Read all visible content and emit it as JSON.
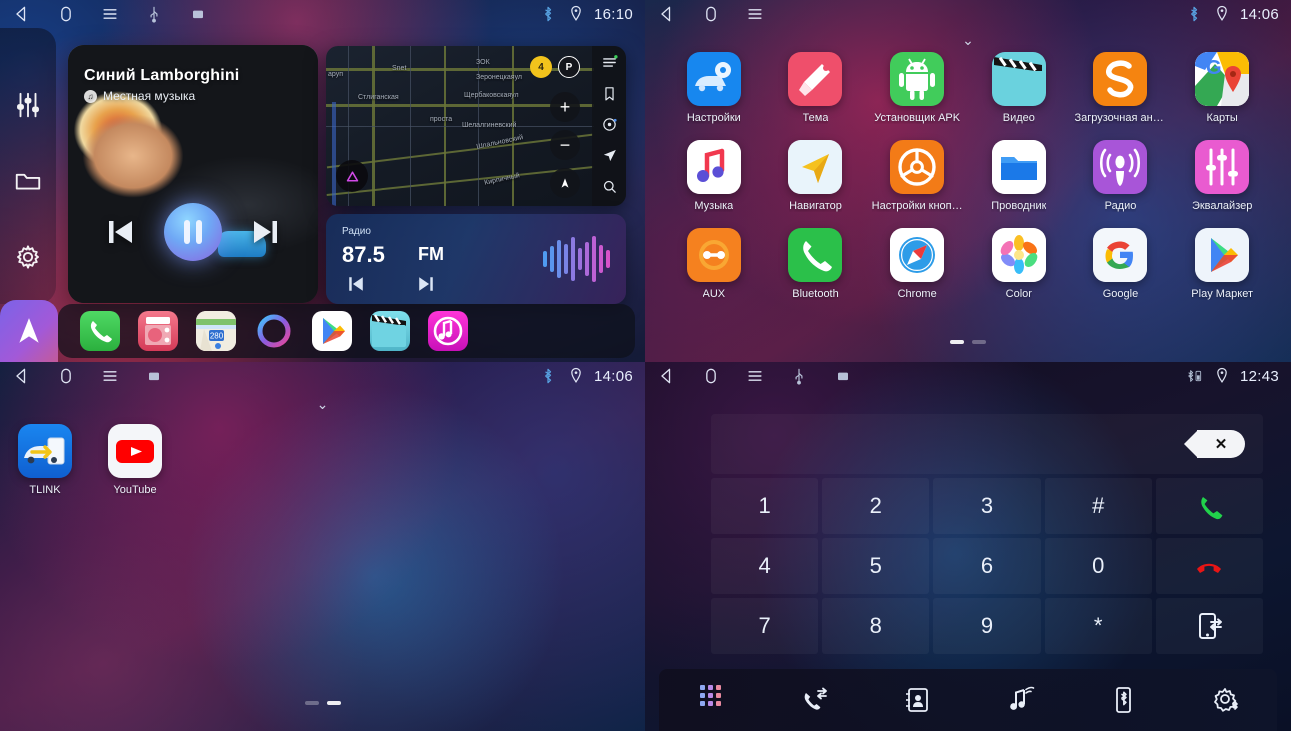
{
  "panels": {
    "media_home": {
      "name": "Media Home Screen",
      "statusbar": {
        "time": "16:10",
        "icons": [
          "back-icon",
          "home-icon",
          "menu-icon",
          "usb-icon",
          "screenshot-icon",
          "bluetooth-icon",
          "location-icon"
        ]
      },
      "sidebar": [
        {
          "name": "equalizer",
          "icon": "sliders-icon"
        },
        {
          "name": "files",
          "icon": "folder-icon"
        },
        {
          "name": "settings",
          "icon": "gear-icon"
        }
      ],
      "nav_tile": {
        "icon": "navigation-arrow-icon"
      },
      "media": {
        "title": "Синий Lamborghini",
        "subtitle": "Местная музыка",
        "source_badge": "♫",
        "prev_label": "prev",
        "play_state": "pause",
        "next_label": "next"
      },
      "map": {
        "labels": [
          "аруп",
          "ЗОК",
          "Зеронецкаяул",
          "Щербаковскаяул",
          "Стлиганская",
          "Шелалгиневский",
          "Шпальновский",
          "Кирпичный",
          "проста",
          "Snet"
        ],
        "badge_count": "4",
        "parking": "P",
        "zoom_in": "+",
        "zoom_out": "−",
        "rail_icons": [
          "menu-icon",
          "bookmark-icon",
          "music-disc-icon",
          "locate-icon",
          "search-icon"
        ]
      },
      "radio": {
        "label": "Радио",
        "frequency": "87.5",
        "band": "FM",
        "prev": "prev-station",
        "next": "next-station"
      },
      "dock": [
        {
          "name": "phone",
          "color": "#3ec152"
        },
        {
          "name": "radio",
          "color": "#e8566e"
        },
        {
          "name": "maps",
          "color": "#f2efe6"
        },
        {
          "name": "siri",
          "color": "#8a5ce0"
        },
        {
          "name": "play-store",
          "color": "#ffffff"
        },
        {
          "name": "video",
          "color": "#6fd0e0"
        },
        {
          "name": "music",
          "color": "#e418c8"
        }
      ]
    },
    "app_grid": {
      "name": "All Apps Screen",
      "statusbar": {
        "time": "14:06",
        "icons": [
          "back-icon",
          "home-icon",
          "menu-icon",
          "bluetooth-icon",
          "location-icon"
        ]
      },
      "pull_chevron": "⌄",
      "apps": [
        {
          "label": "Настройки",
          "icon": "car-settings-icon",
          "bg": "#1787ef"
        },
        {
          "label": "Тема",
          "icon": "brush-icon",
          "bg": "#ef4f6b"
        },
        {
          "label": "Установщик APK",
          "icon": "android-icon",
          "bg": "#41cc5b"
        },
        {
          "label": "Видео",
          "icon": "clapper-icon",
          "bg": "#6ad2de"
        },
        {
          "label": "Загрузочная ани…",
          "icon": "boot-anim-icon",
          "bg": "#f58410"
        },
        {
          "label": "Карты",
          "icon": "google-maps-icon",
          "bg": "#ffffff"
        },
        {
          "label": "Музыка",
          "icon": "music-note-icon",
          "bg": "#ffffff"
        },
        {
          "label": "Навигатор",
          "icon": "navigator-icon",
          "bg": "#e9f4fb"
        },
        {
          "label": "Настройки кноп…",
          "icon": "steering-wheel-icon",
          "bg": "#f37b17"
        },
        {
          "label": "Проводник",
          "icon": "file-manager-icon",
          "bg": "#ffffff"
        },
        {
          "label": "Радио",
          "icon": "podcast-icon",
          "bg": "#a855d8"
        },
        {
          "label": "Эквалайзер",
          "icon": "equalizer-icon",
          "bg": "#e95bd0"
        },
        {
          "label": "AUX",
          "icon": "aux-icon",
          "bg": "#f5811f"
        },
        {
          "label": "Bluetooth",
          "icon": "phone-icon",
          "bg": "#2bc04a"
        },
        {
          "label": "Chrome",
          "icon": "safari-icon",
          "bg": "#ffffff"
        },
        {
          "label": "Color",
          "icon": "photos-icon",
          "bg": "#ffffff"
        },
        {
          "label": "Google",
          "icon": "google-icon",
          "bg": "#f3f7fb"
        },
        {
          "label": "Play Маркет",
          "icon": "play-store-icon",
          "bg": "#eef4fb"
        }
      ],
      "page_indicator": {
        "total": 2,
        "active": 1
      }
    },
    "second_home": {
      "name": "Second Home Screen",
      "statusbar": {
        "time": "14:06",
        "icons": [
          "back-icon",
          "home-icon",
          "menu-icon",
          "screenshot-icon",
          "bluetooth-icon",
          "location-icon"
        ]
      },
      "pull_chevron": "⌄",
      "apps": [
        {
          "label": "TLINK",
          "icon": "tlink-icon",
          "bg": "#1470e0"
        },
        {
          "label": "YouTube",
          "icon": "youtube-icon",
          "bg": "#f4f6f9"
        }
      ],
      "page_indicator": {
        "total": 2,
        "active": 2
      }
    },
    "dialer": {
      "name": "Bluetooth Dialer",
      "statusbar": {
        "time": "12:43",
        "icons": [
          "back-icon",
          "home-icon",
          "menu-icon",
          "usb-icon",
          "screenshot-icon",
          "bluetooth-battery-icon",
          "location-icon"
        ]
      },
      "input": {
        "value": "",
        "placeholder": ""
      },
      "backspace_label": "✕",
      "keys": [
        {
          "label": "1",
          "name": "key-1"
        },
        {
          "label": "2",
          "name": "key-2"
        },
        {
          "label": "3",
          "name": "key-3"
        },
        {
          "label": "#",
          "name": "key-hash"
        },
        {
          "label": "",
          "name": "call-button",
          "icon": "call-icon"
        },
        {
          "label": "4",
          "name": "key-4"
        },
        {
          "label": "5",
          "name": "key-5"
        },
        {
          "label": "6",
          "name": "key-6"
        },
        {
          "label": "0",
          "name": "key-0"
        },
        {
          "label": "",
          "name": "end-call-button",
          "icon": "end-call-icon"
        },
        {
          "label": "7",
          "name": "key-7"
        },
        {
          "label": "8",
          "name": "key-8"
        },
        {
          "label": "9",
          "name": "key-9"
        },
        {
          "label": "*",
          "name": "key-star"
        },
        {
          "label": "",
          "name": "transfer-button",
          "icon": "transfer-call-icon"
        }
      ],
      "toolbar": [
        {
          "name": "keypad-tab",
          "icon": "keypad-grid-icon"
        },
        {
          "name": "call-log-tab",
          "icon": "call-log-icon"
        },
        {
          "name": "contacts-tab",
          "icon": "contacts-book-icon"
        },
        {
          "name": "bt-music-tab",
          "icon": "bt-music-icon"
        },
        {
          "name": "device-tab",
          "icon": "bt-device-icon"
        },
        {
          "name": "bt-settings-tab",
          "icon": "bt-settings-icon"
        }
      ]
    }
  },
  "colors": {
    "accent_green": "#2bc04a",
    "accent_red": "#e02020",
    "accent_blue": "#1787ef",
    "status_text": "#e8eefc"
  }
}
